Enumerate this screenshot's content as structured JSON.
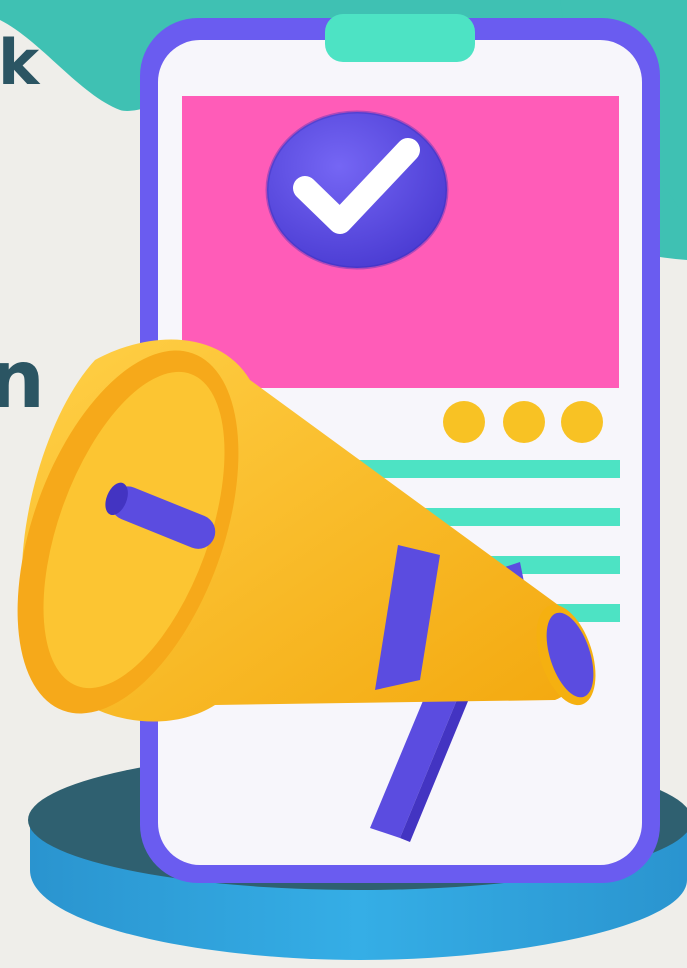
{
  "edge_text": {
    "top_letter": "k",
    "middle_letter": "n"
  },
  "phone": {
    "header_dots": 3,
    "content_lines": 4
  },
  "colors": {
    "background": "#efeeea",
    "teal_blob": "#3fc1b3",
    "phone_frame": "#6a5cf0",
    "phone_screen": "#f7f6fb",
    "header_panel": "#ff5cb8",
    "check_badge": "#5b4ce0",
    "content_lines": "#4de3c4",
    "dots": "#f8c224",
    "megaphone": "#f9b81b",
    "podium_top": "#2f6070",
    "podium_side": "#2d9ed6"
  },
  "icons": {
    "badge": "check-icon",
    "main": "megaphone-icon"
  }
}
